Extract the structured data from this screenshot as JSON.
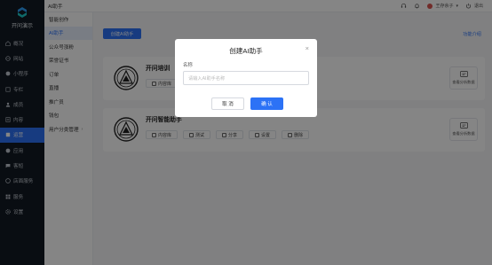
{
  "app": {
    "title": "开问演示"
  },
  "nav": {
    "items": [
      {
        "label": "概况",
        "icon": "home-icon"
      },
      {
        "label": "网站",
        "icon": "globe-icon"
      },
      {
        "label": "小程序",
        "icon": "miniapp-icon"
      },
      {
        "label": "专栏",
        "icon": "column-icon"
      },
      {
        "label": "成员",
        "icon": "user-icon"
      },
      {
        "label": "内容",
        "icon": "content-icon"
      },
      {
        "label": "运营",
        "icon": "operation-icon"
      },
      {
        "label": "应用",
        "icon": "apps-icon"
      },
      {
        "label": "客短",
        "icon": "message-icon"
      },
      {
        "label": "店面服务",
        "icon": "store-icon"
      },
      {
        "label": "服务",
        "icon": "service-icon"
      },
      {
        "label": "设置",
        "icon": "settings-icon"
      }
    ],
    "active_index": 6
  },
  "submenu": {
    "items": [
      {
        "label": "智能创作"
      },
      {
        "label": "AI助手"
      },
      {
        "label": "公众号涨粉"
      },
      {
        "label": "荣誉证书"
      },
      {
        "label": "订单"
      },
      {
        "label": "直播"
      },
      {
        "label": "推广员"
      },
      {
        "label": "钱包"
      },
      {
        "label": "用户分类管理",
        "chevron": "›"
      }
    ],
    "active_index": 1
  },
  "header": {
    "breadcrumb": "AI助手",
    "user_name": "王存余子",
    "logout_label": "退出",
    "avatar_color": "#d9534f"
  },
  "main": {
    "create_button": "创建AI助手",
    "help_link": "功能介绍",
    "cards": [
      {
        "name": "开问培训",
        "actions": [
          {
            "label": "内容库",
            "icon": "library-icon"
          }
        ],
        "analytics_label": "查看分析数据"
      },
      {
        "name": "开问智能助手",
        "actions": [
          {
            "label": "内容库",
            "icon": "library-icon"
          },
          {
            "label": "测试",
            "icon": "test-icon"
          },
          {
            "label": "分享",
            "icon": "share-icon"
          },
          {
            "label": "设置",
            "icon": "gear-icon"
          },
          {
            "label": "删除",
            "icon": "trash-icon"
          }
        ],
        "analytics_label": "查看分析数据"
      }
    ]
  },
  "modal": {
    "title": "创建AI助手",
    "close": "×",
    "field_label": "名称",
    "field_placeholder": "请输入AI助手名称",
    "field_value": "",
    "cancel_label": "取 消",
    "confirm_label": "确 认"
  },
  "colors": {
    "accent": "#2c72f6",
    "nav_bg": "#121a23",
    "overlay": "rgba(0,0,0,0.48)"
  }
}
